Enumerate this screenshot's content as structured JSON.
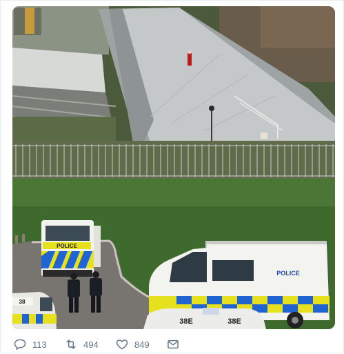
{
  "image_alt": "Person standing on the roof of a railway station while police vehicles wait below",
  "vehicles": {
    "van_front_label": "POLICE",
    "van_side_label": "POLICE",
    "car_roof_code_1": "38E",
    "car_roof_code_2": "38E",
    "car_left_roof_code": "38"
  },
  "actions": {
    "reply_count": "113",
    "retweet_count": "494",
    "like_count": "849"
  },
  "icons": [
    "reply-icon",
    "retweet-icon",
    "like-icon",
    "message-icon"
  ],
  "colors": {
    "icon_gray": "#657786",
    "police_yellow": "#e6e01e",
    "police_blue": "#1f64d1"
  }
}
